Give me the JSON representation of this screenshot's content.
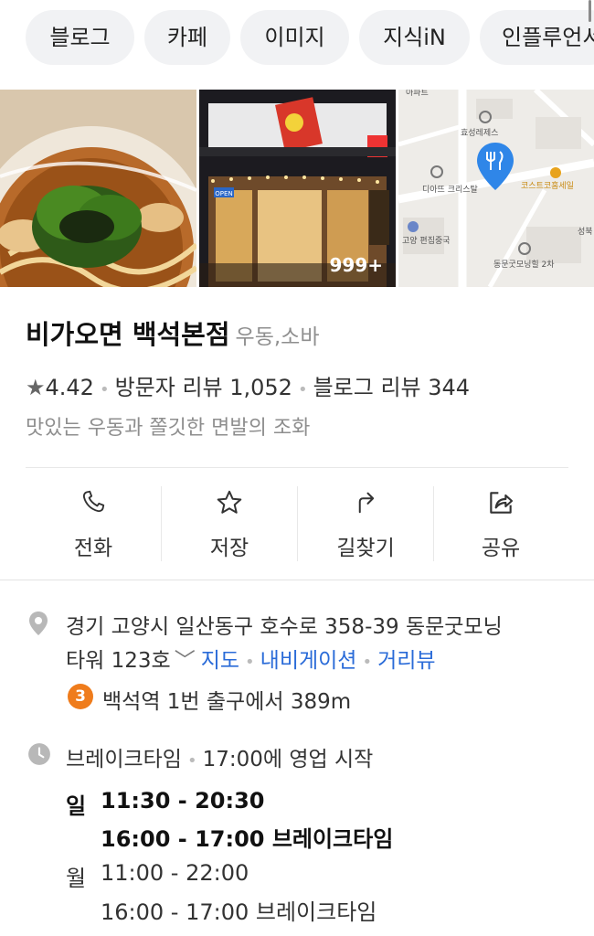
{
  "tabs": [
    "블로그",
    "카페",
    "이미지",
    "지식iN",
    "인플루언서"
  ],
  "photos": {
    "count": "999+",
    "storefront_sign": "OPEN",
    "map_labels": [
      "아파트",
      "효성레제스",
      "디아뜨 크리스탈",
      "코스트코홈세일",
      "고양 편집중국",
      "동문굿모닝힐 2차",
      "성북"
    ]
  },
  "place": {
    "name": "비가오면 백석본점",
    "category": "우동,소바",
    "rating": "4.42",
    "visitor_reviews": "방문자 리뷰 1,052",
    "blog_reviews": "블로그 리뷰 344",
    "description": "맛있는 우동과 쫄깃한 면발의 조화"
  },
  "actions": [
    {
      "label": "전화",
      "icon": "phone-icon"
    },
    {
      "label": "저장",
      "icon": "star-outline-icon"
    },
    {
      "label": "길찾기",
      "icon": "directions-icon"
    },
    {
      "label": "공유",
      "icon": "share-icon"
    }
  ],
  "address": {
    "line1": "경기 고양시 일산동구 호수로 358-39 동문굿모닝",
    "line2": "타워 123호",
    "links": [
      "지도",
      "내비게이션",
      "거리뷰"
    ]
  },
  "subway": {
    "line": "3",
    "text": "백석역 1번 출구에서 389m"
  },
  "hours": {
    "status_label": "브레이크타임",
    "status_detail": "17:00에 영업 시작",
    "days": [
      {
        "day": "일",
        "open": "11:30 - 20:30",
        "break": "16:00 - 17:00 브레이크타임",
        "today": true
      },
      {
        "day": "월",
        "open": "11:00 - 22:00",
        "break": "16:00 - 17:00 브레이크타임",
        "today": false
      }
    ]
  },
  "colors": {
    "link": "#2a6bd8",
    "subway_line3": "#ef7c1c",
    "map_pin": "#2f86e8"
  }
}
